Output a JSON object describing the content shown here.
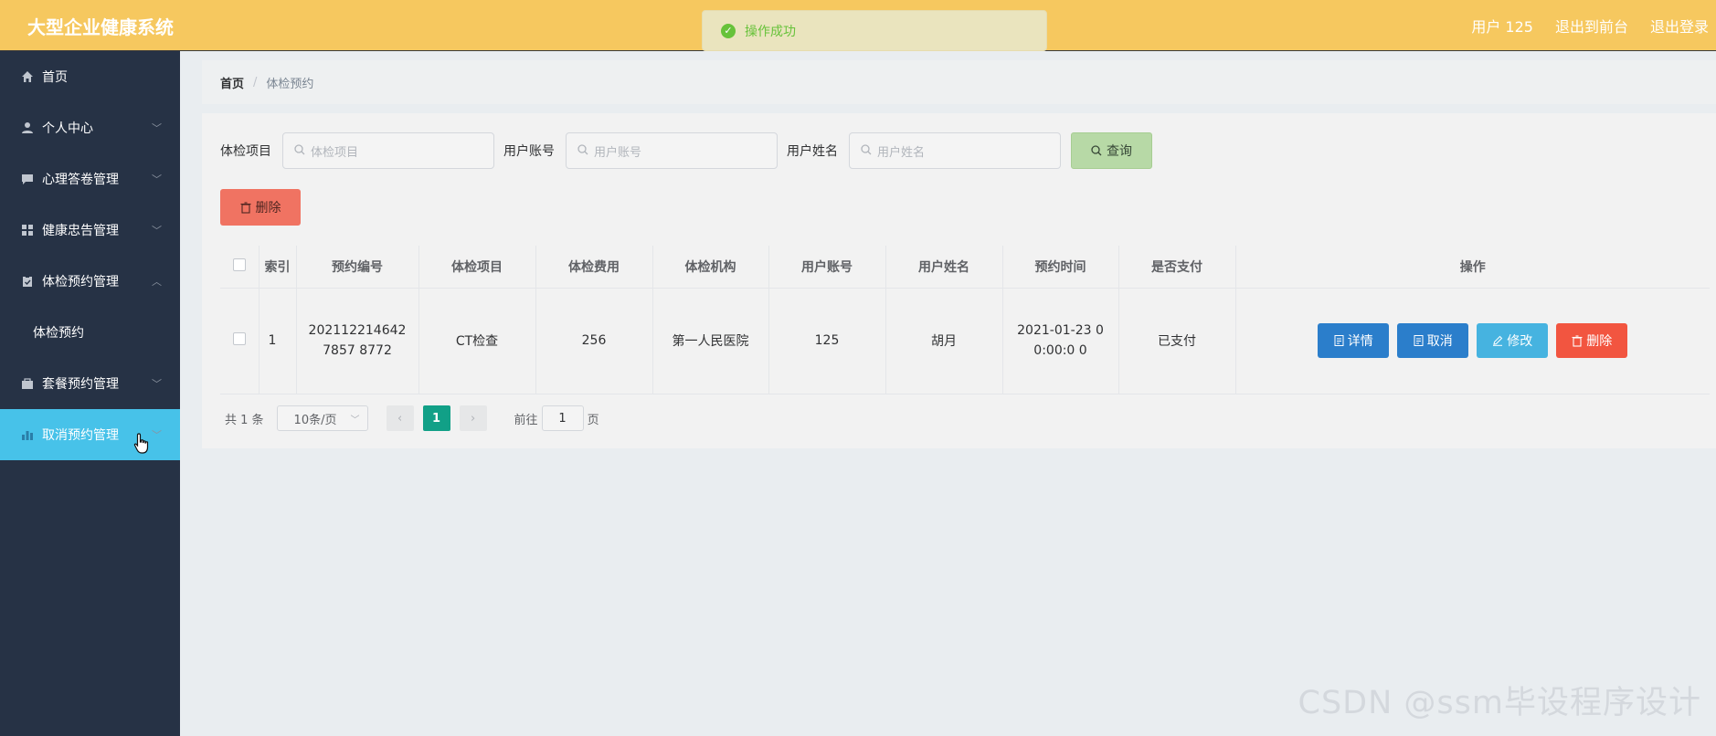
{
  "header": {
    "brand": "大型企业健康系统",
    "user_label": "用户 125",
    "back_label": "退出到前台",
    "logout_label": "退出登录"
  },
  "toast": {
    "message": "操作成功",
    "icon": "check-circle-icon",
    "color": "#67c23a"
  },
  "sidebar": {
    "items": [
      {
        "label": "首页",
        "icon": "home-icon",
        "has_chevron": false
      },
      {
        "label": "个人中心",
        "icon": "user-icon",
        "has_chevron": true
      },
      {
        "label": "心理答卷管理",
        "icon": "chat-icon",
        "has_chevron": true
      },
      {
        "label": "健康忠告管理",
        "icon": "grid-icon",
        "has_chevron": true
      },
      {
        "label": "体检预约管理",
        "icon": "clipboard-icon",
        "has_chevron": true
      },
      {
        "label": "体检预约",
        "icon": "",
        "has_chevron": false
      },
      {
        "label": "套餐预约管理",
        "icon": "briefcase-icon",
        "has_chevron": true
      },
      {
        "label": "取消预约管理",
        "icon": "bar-chart-icon",
        "has_chevron": true
      }
    ],
    "active_color": "#47c2e9",
    "bg_color": "#263245"
  },
  "breadcrumb": {
    "home": "首页",
    "separator": "/",
    "current": "体检预约"
  },
  "search": {
    "fields": [
      {
        "label": "体检项目",
        "placeholder": "体检项目"
      },
      {
        "label": "用户账号",
        "placeholder": "用户账号"
      },
      {
        "label": "用户姓名",
        "placeholder": "用户姓名"
      }
    ],
    "query_label": "查询"
  },
  "actions": {
    "delete_label": "删除"
  },
  "table": {
    "headers": [
      "索引",
      "预约编号",
      "体检项目",
      "体检费用",
      "体检机构",
      "用户账号",
      "用户姓名",
      "预约时间",
      "是否支付",
      "操作"
    ],
    "rows": [
      {
        "index": "1",
        "booking_no": "2021122146427857 8772",
        "item": "CT检查",
        "fee": "256",
        "institution": "第一人民医院",
        "account": "125",
        "name": "胡月",
        "time": "2021-01-23 00:00:0 0",
        "paid": "已支付"
      }
    ],
    "row_actions": {
      "detail": "详情",
      "cancel": "取消",
      "edit": "修改",
      "delete": "删除"
    }
  },
  "pagination": {
    "total_text": "共 1 条",
    "page_size": "10条/页",
    "current_page": "1",
    "goto_label": "前往",
    "goto_value": "1",
    "page_suffix": "页"
  },
  "watermark": "CSDN @ssm毕设程序设计"
}
